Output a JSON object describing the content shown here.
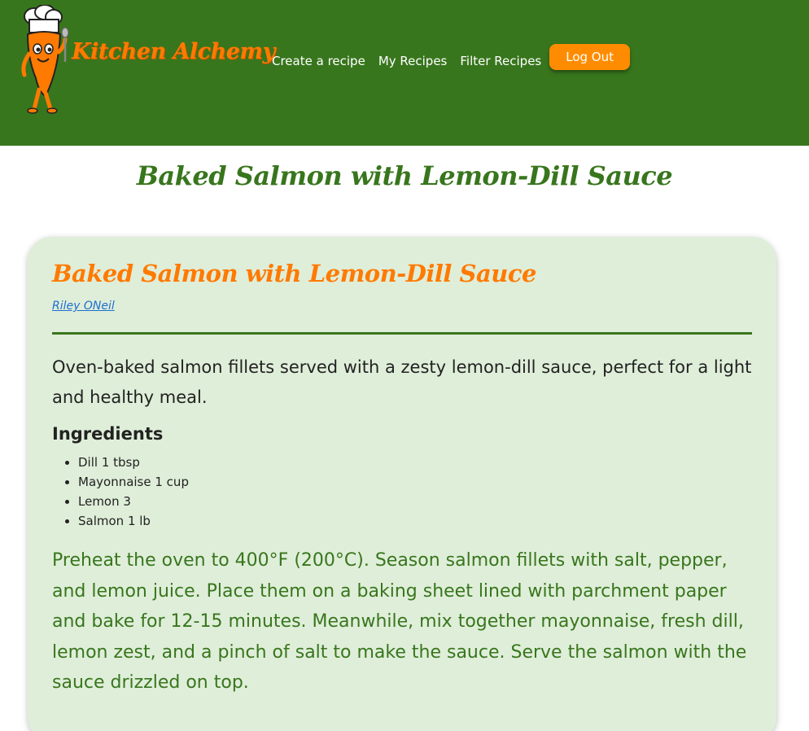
{
  "brand": {
    "name": "Kitchen Alchemy",
    "logo_icon": "chef-carrot-mascot"
  },
  "nav": {
    "items": [
      {
        "label": "Create a recipe"
      },
      {
        "label": "My Recipes"
      },
      {
        "label": "Filter Recipes"
      }
    ],
    "logout_label": "Log Out"
  },
  "page": {
    "title": "Baked Salmon with Lemon-Dill Sauce"
  },
  "recipe": {
    "title": "Baked Salmon with Lemon-Dill Sauce",
    "author": "Riley ONeil",
    "description": "Oven-baked salmon fillets served with a zesty lemon-dill sauce, perfect for a light and healthy meal.",
    "ingredients_heading": "Ingredients",
    "ingredients": [
      "Dill 1 tbsp",
      "Mayonnaise 1 cup",
      "Lemon 3",
      "Salmon 1 lb"
    ],
    "instructions": "Preheat the oven to 400°F (200°C). Season salmon fillets with salt, pepper, and lemon juice. Place them on a baking sheet lined with parchment paper and bake for 12-15 minutes. Meanwhile, mix together mayonnaise, fresh dill, lemon zest, and a pinch of salt to make the sauce. Serve the salmon with the sauce drizzled on top."
  },
  "colors": {
    "header_bg": "#38761d",
    "accent_orange": "#ff7a00",
    "button_orange": "#ff8c00",
    "card_bg": "#dfeed9",
    "link_blue": "#1e6fd0"
  }
}
